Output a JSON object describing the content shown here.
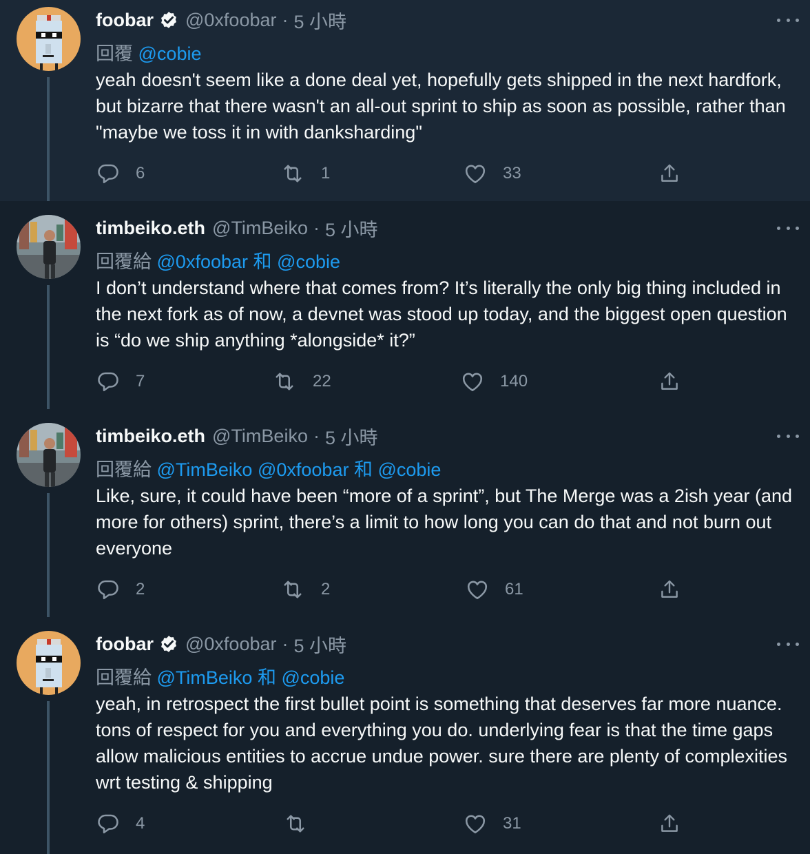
{
  "labels": {
    "reply_prefix": "回覆",
    "reply_to_prefix": "回覆給",
    "and": "和",
    "dot": "·"
  },
  "colors": {
    "background": "#15202b",
    "highlight_background": "#1b2836",
    "accent": "#1d9bf0",
    "muted": "#8b98a5",
    "text": "#f7f9f9"
  },
  "icons": [
    "verified-badge-icon",
    "more-options-icon",
    "reply-icon",
    "retweet-icon",
    "like-icon",
    "share-icon"
  ],
  "tweets": [
    {
      "name": "foobar",
      "verified": true,
      "handle": "@0xfoobar",
      "time": "5 小時",
      "reply_prefix": "回覆",
      "reply_mentions": [
        "@cobie"
      ],
      "text": "yeah doesn't seem like a done deal yet, hopefully gets shipped in the next hardfork, but bizarre that there wasn't an all-out sprint to ship as soon as possible, rather than \"maybe we toss it in with danksharding\"",
      "replies": "6",
      "retweets": "1",
      "likes": "33"
    },
    {
      "name": "timbeiko.eth",
      "verified": false,
      "handle": "@TimBeiko",
      "time": "5 小時",
      "reply_prefix": "回覆給",
      "reply_mentions": [
        "@0xfoobar",
        "@cobie"
      ],
      "text": "I don’t understand where that comes from? It’s literally the only big thing included in the next fork as of now, a devnet was stood up today, and the biggest open question is “do we ship anything *alongside* it?”",
      "replies": "7",
      "retweets": "22",
      "likes": "140"
    },
    {
      "name": "timbeiko.eth",
      "verified": false,
      "handle": "@TimBeiko",
      "time": "5 小時",
      "reply_prefix": "回覆給",
      "reply_mentions": [
        "@TimBeiko",
        "@0xfoobar",
        "@cobie"
      ],
      "text": "Like, sure, it could have been “more of a sprint”, but The Merge was a 2ish year (and more for others) sprint, there’s a limit to how long you can do that and not burn out everyone",
      "replies": "2",
      "retweets": "2",
      "likes": "61"
    },
    {
      "name": "foobar",
      "verified": true,
      "handle": "@0xfoobar",
      "time": "5 小時",
      "reply_prefix": "回覆給",
      "reply_mentions": [
        "@TimBeiko",
        "@cobie"
      ],
      "text": "yeah, in retrospect the first bullet point is something that deserves far more nuance. tons of respect for you and everything you do. underlying fear is that the time gaps allow malicious entities to accrue undue power. sure there are plenty of complexities wrt testing & shipping",
      "replies": "4",
      "retweets": "",
      "likes": "31"
    }
  ]
}
